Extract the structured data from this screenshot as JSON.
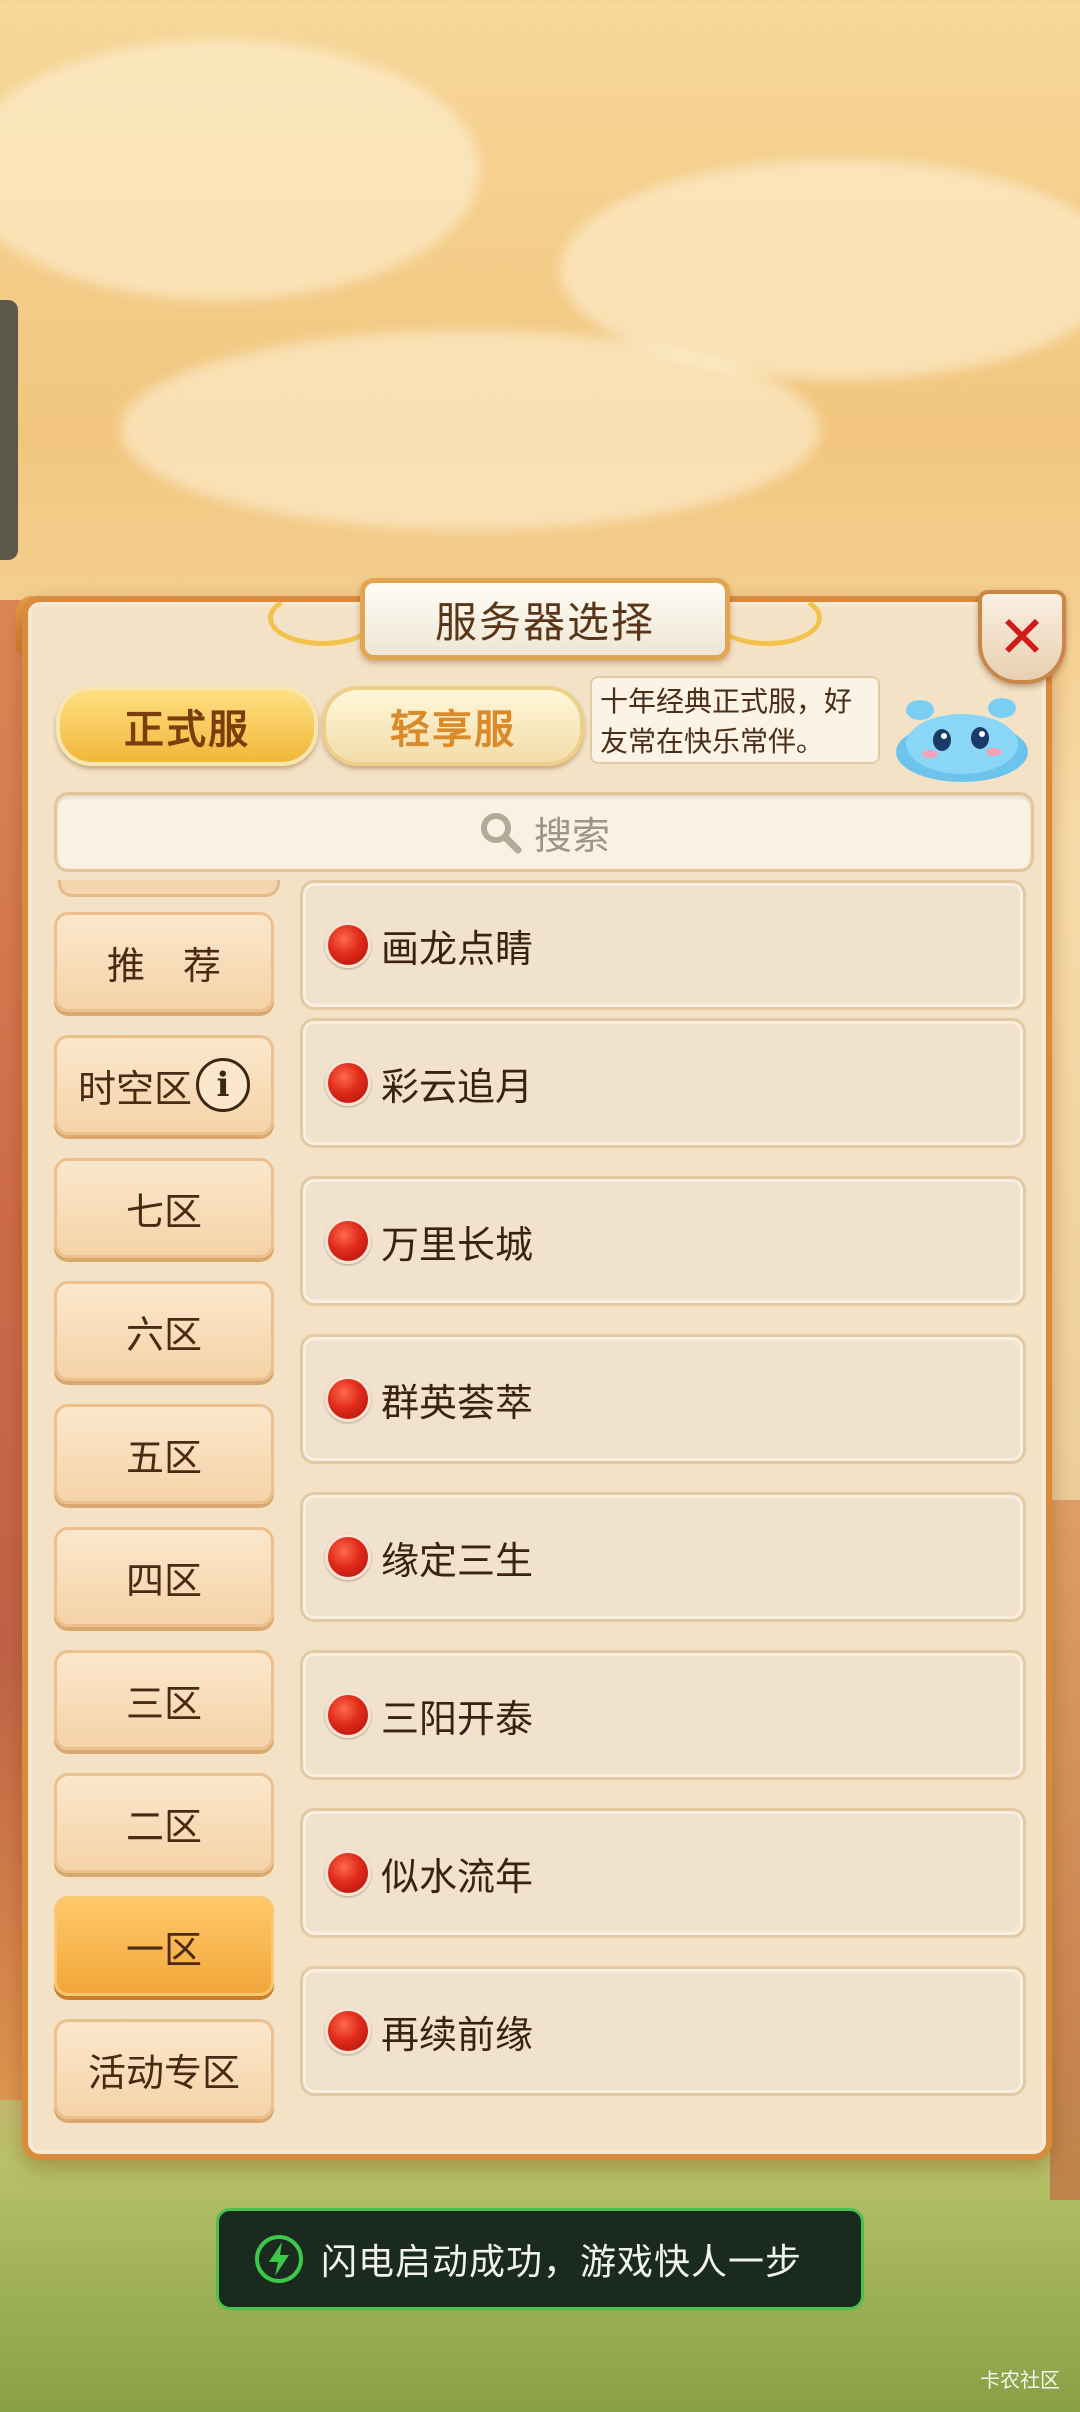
{
  "dialog": {
    "title": "服务器选择",
    "close_icon": "close-icon"
  },
  "tabs": [
    {
      "label": "正式服",
      "active": true
    },
    {
      "label": "轻享服",
      "active": false
    }
  ],
  "tip": {
    "line1": "十年经典正式服，好",
    "line2": "友常在快乐常伴。"
  },
  "search": {
    "placeholder": "搜索",
    "icon": "search-icon"
  },
  "categories": [
    {
      "label": "推　荐",
      "active": false
    },
    {
      "label": "时空区",
      "active": false,
      "has_info_icon": true
    },
    {
      "label": "七区",
      "active": false
    },
    {
      "label": "六区",
      "active": false
    },
    {
      "label": "五区",
      "active": false
    },
    {
      "label": "四区",
      "active": false
    },
    {
      "label": "三区",
      "active": false
    },
    {
      "label": "二区",
      "active": false
    },
    {
      "label": "一区",
      "active": true
    },
    {
      "label": "活动专区",
      "active": false
    }
  ],
  "servers": [
    {
      "name": "画龙点睛",
      "status": "red"
    },
    {
      "name": "彩云追月",
      "status": "red"
    },
    {
      "name": "万里长城",
      "status": "red"
    },
    {
      "name": "群英荟萃",
      "status": "red"
    },
    {
      "name": "缘定三生",
      "status": "red"
    },
    {
      "name": "三阳开泰",
      "status": "red"
    },
    {
      "name": "似水流年",
      "status": "red"
    },
    {
      "name": "再续前缘",
      "status": "red"
    }
  ],
  "toast": {
    "text": "闪电启动成功，游戏快人一步",
    "icon": "lightning-icon"
  },
  "watermark": "卡农社区",
  "colors": {
    "accent": "#f2a63a",
    "status_red": "#e02a1a",
    "toast_border": "#4bbf4f"
  }
}
